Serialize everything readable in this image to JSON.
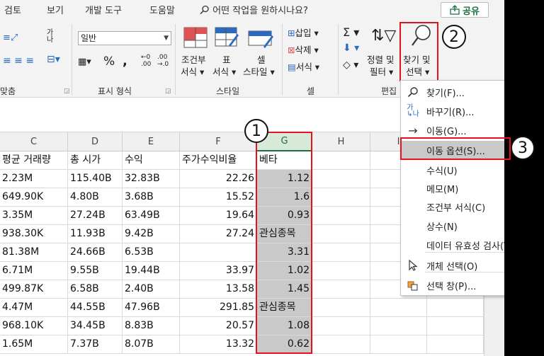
{
  "menu": {
    "tabs": [
      "검토",
      "보기",
      "개발 도구",
      "도움말"
    ],
    "search_placeholder": "어떤 작업을 원하시나요?",
    "share_label": "공유"
  },
  "ribbon": {
    "number_format_value": "일반",
    "percent_symbol": "%",
    "comma_symbol": "❜",
    "group_labels": {
      "alignment": "맞춤",
      "number": "표시 형식",
      "styles": "스타일",
      "cells": "셀",
      "editing": "편집"
    },
    "styles": {
      "conditional_line1": "조건부",
      "conditional_line2": "서식",
      "table_line1": "표",
      "table_line2": "서식",
      "cell_line1": "셀",
      "cell_line2": "스타일"
    },
    "cells": {
      "insert": "삽입",
      "delete": "삭제",
      "format": "서식"
    },
    "editing": {
      "sort_line1": "정렬 및",
      "sort_line2": "필터",
      "find_line1": "찾기 및",
      "find_line2": "선택"
    }
  },
  "badges": {
    "one": "1",
    "two": "2",
    "three": "3"
  },
  "grid": {
    "columns": [
      "C",
      "D",
      "E",
      "F",
      "G",
      "H",
      "I"
    ],
    "headers": [
      "평균 거래량",
      "총 시가",
      "수익",
      "주가수익비율",
      "베타"
    ],
    "rows": [
      [
        "2.23M",
        "115.40B",
        "32.83B",
        "22.26",
        "1.12"
      ],
      [
        "649.90K",
        "4.80B",
        "3.68B",
        "15.52",
        "1.6"
      ],
      [
        "3.35M",
        "27.24B",
        "63.49B",
        "19.64",
        "0.93"
      ],
      [
        "938.30K",
        "11.93B",
        "9.42B",
        "27.24",
        "관심종목"
      ],
      [
        "81.38M",
        "24.66B",
        "6.53B",
        "",
        "3.31"
      ],
      [
        "6.71M",
        "9.55B",
        "19.44B",
        "33.97",
        "1.02"
      ],
      [
        "499.87K",
        "6.58B",
        "2.40B",
        "13.58",
        "1.45"
      ],
      [
        "4.47M",
        "44.55B",
        "47.96B",
        "291.85",
        "관심종목"
      ],
      [
        "968.10K",
        "34.45B",
        "8.83B",
        "20.57",
        "1.08"
      ],
      [
        "1.65M",
        "7.37B",
        "8.07B",
        "13.32",
        "0.62"
      ]
    ]
  },
  "dropdown": {
    "items": [
      {
        "label": "찾기(F)...",
        "icon": "search-icon"
      },
      {
        "label": "바꾸기(R)...",
        "icon": "replace-icon"
      },
      {
        "label": "이동(G)...",
        "icon": "arrow-right-icon"
      },
      {
        "label": "이동 옵션(S)...",
        "icon": "",
        "active": true
      },
      {
        "label": "수식(U)",
        "icon": ""
      },
      {
        "label": "메모(M)",
        "icon": ""
      },
      {
        "label": "조건부 서식(C)",
        "icon": ""
      },
      {
        "label": "상수(N)",
        "icon": ""
      },
      {
        "label": "데이터 유효성 검사(V)",
        "icon": ""
      },
      {
        "label": "개체 선택(O)",
        "icon": "cursor-icon"
      },
      {
        "label": "선택 창(P)...",
        "icon": "selection-pane-icon"
      }
    ]
  },
  "colors": {
    "highlight": "#e3121b",
    "excel_green": "#1e6f3f",
    "selection_gray": "#c9c9c9"
  }
}
